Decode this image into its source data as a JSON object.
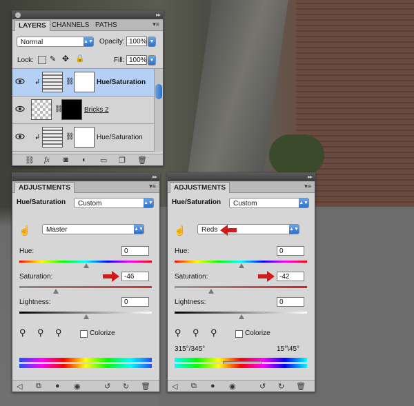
{
  "layers_panel": {
    "tabs": [
      "LAYERS",
      "CHANNELS",
      "PATHS"
    ],
    "blend_mode": "Normal",
    "opacity_label": "Opacity:",
    "opacity_value": "100%",
    "lock_label": "Lock:",
    "fill_label": "Fill:",
    "fill_value": "100%",
    "layers": [
      {
        "name": "Hue/Saturation",
        "selected": true
      },
      {
        "name": "Bricks 2",
        "selected": false
      },
      {
        "name": "Hue/Saturation",
        "selected": false
      }
    ]
  },
  "adjustments_left": {
    "tab": "ADJUSTMENTS",
    "title": "Hue/Saturation",
    "preset": "Custom",
    "channel": "Master",
    "hue_label": "Hue:",
    "hue_value": "0",
    "saturation_label": "Saturation:",
    "saturation_value": "-46",
    "lightness_label": "Lightness:",
    "lightness_value": "0",
    "colorize_label": "Colorize"
  },
  "adjustments_right": {
    "tab": "ADJUSTMENTS",
    "title": "Hue/Saturation",
    "preset": "Custom",
    "channel": "Reds",
    "hue_label": "Hue:",
    "hue_value": "0",
    "saturation_label": "Saturation:",
    "saturation_value": "-42",
    "lightness_label": "Lightness:",
    "lightness_value": "0",
    "colorize_label": "Colorize",
    "range_left": "315°/345°",
    "range_right": "15°\\45°"
  },
  "colors": {
    "selection": "#b5d0f5",
    "accent_blue": "#2f6fc7",
    "annotation_red": "#d11a1a"
  }
}
